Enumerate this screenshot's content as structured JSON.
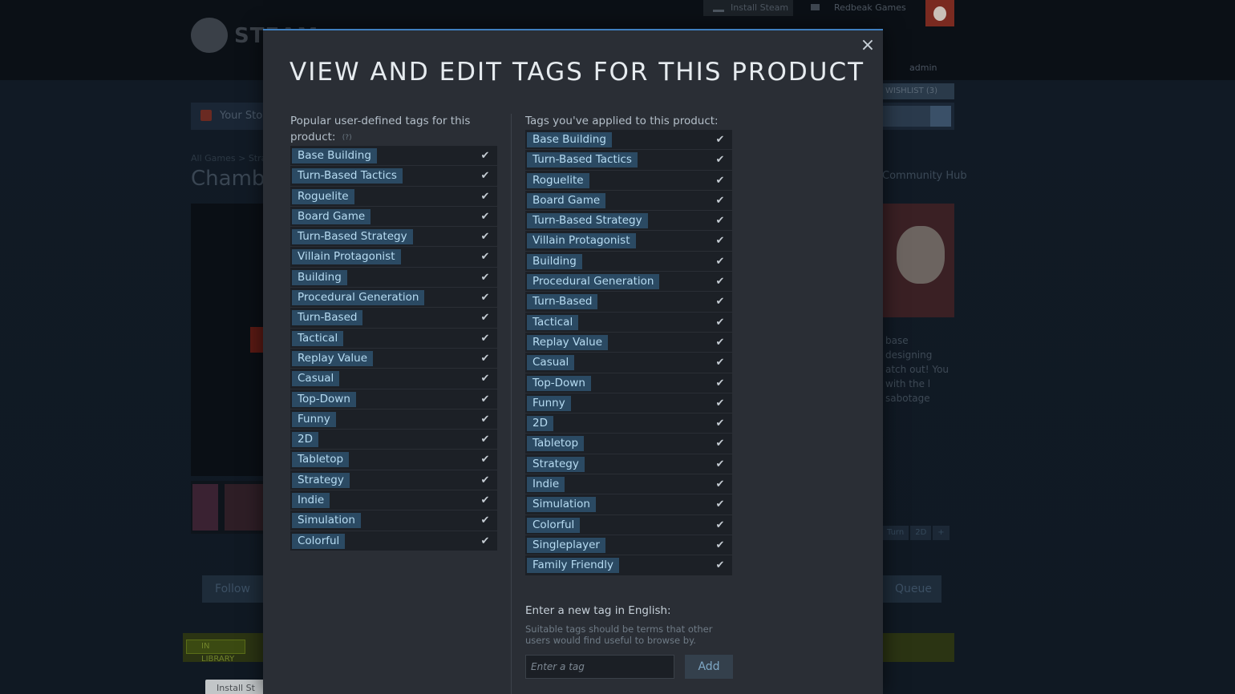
{
  "background": {
    "install_steam": "Install Steam",
    "account_name": "Redbeak Games",
    "logo_text": "STEAM",
    "admin_label": "admin",
    "wishlist": "WISHLIST (3)",
    "store_nav_label": "Your Store",
    "breadcrumbs": "All Games > Strategy",
    "game_title": "Chamber",
    "community_hub": "Community Hub",
    "description": "base designing atch out! You with the l sabotage",
    "mini_tags": [
      "Turn",
      "2D",
      "+"
    ],
    "follow": "Follow",
    "queue": "Queue",
    "library_badge": "IN LIBRARY",
    "install_game": "Install St"
  },
  "modal": {
    "title": "VIEW AND EDIT TAGS FOR THIS PRODUCT",
    "close_symbol": "×",
    "left_heading": "Popular user-defined tags for this product:",
    "right_heading": "Tags you've applied to this product:",
    "help_marker": "(?)",
    "check_symbol": "✔",
    "popular_tags": [
      "Base Building",
      "Turn-Based Tactics",
      "Roguelite",
      "Board Game",
      "Turn-Based Strategy",
      "Villain Protagonist",
      "Building",
      "Procedural Generation",
      "Turn-Based",
      "Tactical",
      "Replay Value",
      "Casual",
      "Top-Down",
      "Funny",
      "2D",
      "Tabletop",
      "Strategy",
      "Indie",
      "Simulation",
      "Colorful"
    ],
    "applied_tags": [
      "Base Building",
      "Turn-Based Tactics",
      "Roguelite",
      "Board Game",
      "Turn-Based Strategy",
      "Villain Protagonist",
      "Building",
      "Procedural Generation",
      "Turn-Based",
      "Tactical",
      "Replay Value",
      "Casual",
      "Top-Down",
      "Funny",
      "2D",
      "Tabletop",
      "Strategy",
      "Indie",
      "Simulation",
      "Colorful",
      "Singleplayer",
      "Family Friendly"
    ],
    "new_tag": {
      "heading": "Enter a new tag in English:",
      "hint": "Suitable tags should be terms that other users would find useful to browse by.",
      "placeholder": "Enter a tag",
      "value": "",
      "add_label": "Add"
    }
  },
  "colors": {
    "accent": "#3f7fbf",
    "chip_bg": "#2b4a63",
    "chip_text": "#b7dcf2",
    "modal_bg": "#2a2e35"
  }
}
